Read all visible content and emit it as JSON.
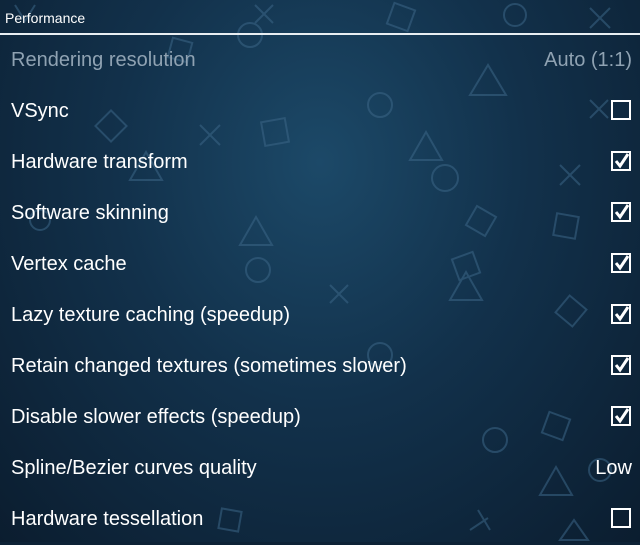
{
  "header": {
    "title": "Performance"
  },
  "rows": [
    {
      "label": "Rendering resolution",
      "type": "value",
      "value": "Auto (1:1)",
      "disabled": true
    },
    {
      "label": "VSync",
      "type": "checkbox",
      "checked": false
    },
    {
      "label": "Hardware transform",
      "type": "checkbox",
      "checked": true
    },
    {
      "label": "Software skinning",
      "type": "checkbox",
      "checked": true
    },
    {
      "label": "Vertex cache",
      "type": "checkbox",
      "checked": true
    },
    {
      "label": "Lazy texture caching (speedup)",
      "type": "checkbox",
      "checked": true
    },
    {
      "label": "Retain changed textures (sometimes slower)",
      "type": "checkbox",
      "checked": true
    },
    {
      "label": "Disable slower effects (speedup)",
      "type": "checkbox",
      "checked": true
    },
    {
      "label": "Spline/Bezier curves quality",
      "type": "value",
      "value": "Low"
    },
    {
      "label": "Hardware tessellation",
      "type": "checkbox",
      "checked": false
    }
  ]
}
